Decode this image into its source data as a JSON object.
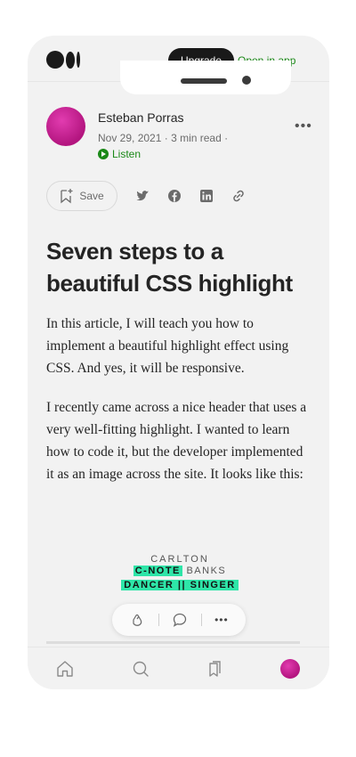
{
  "topbar": {
    "upgrade_label": "Upgrade",
    "open_app_label": "Open in app"
  },
  "author": {
    "name": "Esteban Porras",
    "date": "Nov 29, 2021",
    "read_time": "3 min read",
    "listen_label": "Listen",
    "more_label": "•••"
  },
  "actions": {
    "save_label": "Save",
    "share_icons": [
      "twitter-icon",
      "facebook-icon",
      "linkedin-icon",
      "link-icon"
    ]
  },
  "article": {
    "title": "Seven steps to a beautiful CSS highlight",
    "paragraphs": [
      "In this article, I will teach you how to implement a beautiful highlight effect using CSS. And yes, it will be responsive.",
      "I recently came across a nice header that uses a very well-fitting highlight. I wanted to learn how to code it, but the developer implemented it as an image across the site. It looks like this:"
    ],
    "image": {
      "line1": "CARLTON",
      "line2_highlight": "C-NOTE",
      "line2_rest": " BANKS",
      "line3": "DANCER || SINGER",
      "highlight_color": "#2ee5a8"
    }
  },
  "float_bar": {
    "more_label": "•••"
  },
  "bottom_nav": {
    "items": [
      "home-icon",
      "search-icon",
      "bookmarks-icon",
      "profile-avatar"
    ]
  },
  "colors": {
    "accent_green": "#1a8917",
    "avatar_magenta": "#c61f92",
    "background": "#f2f2f2"
  }
}
